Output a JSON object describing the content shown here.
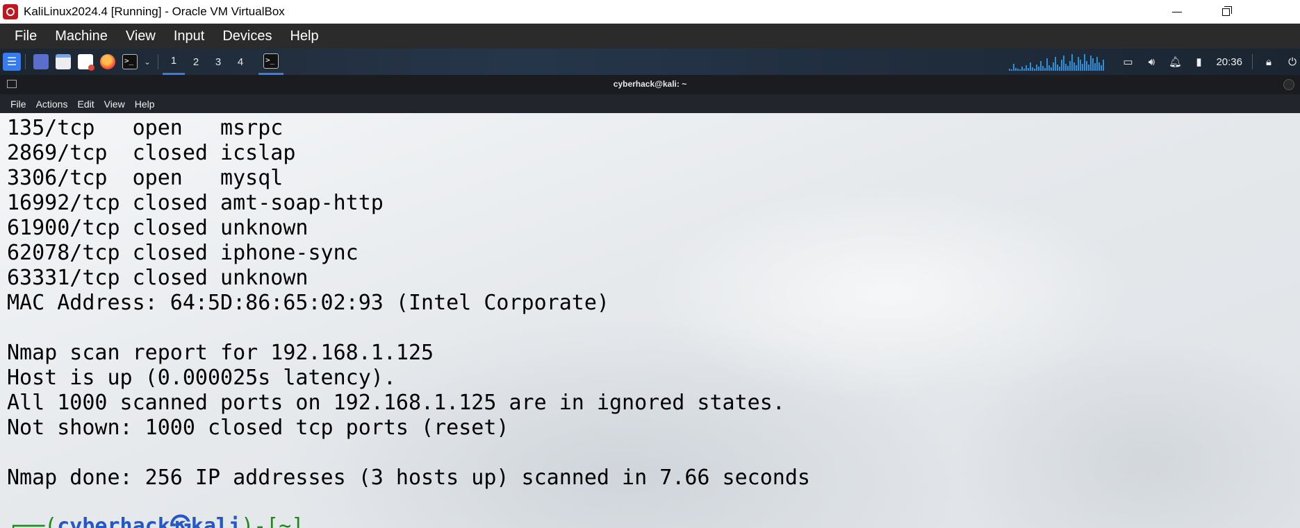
{
  "host_window": {
    "title": "KaliLinux2024.4 [Running] - Oracle VM VirtualBox"
  },
  "vbox_menu": [
    "File",
    "Machine",
    "View",
    "Input",
    "Devices",
    "Help"
  ],
  "kali_panel": {
    "workspaces": [
      "1",
      "2",
      "3",
      "4"
    ],
    "active_workspace": "1",
    "clock": "20:36",
    "accent_color": "#367bf0"
  },
  "terminal": {
    "title": "cyberhack@kali: ~",
    "menu": [
      "File",
      "Actions",
      "Edit",
      "View",
      "Help"
    ],
    "lines": [
      "135/tcp   open   msrpc",
      "2869/tcp  closed icslap",
      "3306/tcp  open   mysql",
      "16992/tcp closed amt-soap-http",
      "61900/tcp closed unknown",
      "62078/tcp closed iphone-sync",
      "63331/tcp closed unknown",
      "MAC Address: 64:5D:86:65:02:93 (Intel Corporate)",
      "",
      "Nmap scan report for 192.168.1.125",
      "Host is up (0.000025s latency).",
      "All 1000 scanned ports on 192.168.1.125 are in ignored states.",
      "Not shown: 1000 closed tcp ports (reset)",
      "",
      "Nmap done: 256 IP addresses (3 hosts up) scanned in 7.66 seconds"
    ],
    "prompt": {
      "prefix": "┌──(",
      "user": "cyberhack㉿kali",
      "suffix": ")-[~]"
    }
  }
}
